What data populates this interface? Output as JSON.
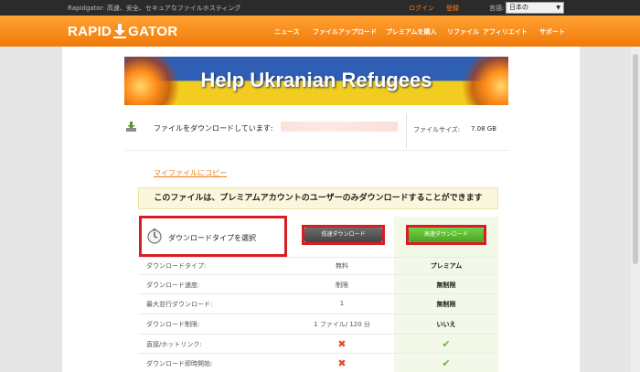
{
  "topbar": {
    "tagline": "Rapidgator: 高速、安全、セキュアなファイルホスティング",
    "login": "ログイン",
    "register": "登録",
    "language_label": "言語:",
    "language_value": "日本の"
  },
  "header": {
    "logo_left": "RAPID",
    "logo_right": "GATOR",
    "nav": [
      "ニュース",
      "ファイルアップロード",
      "プレミアムを購入",
      "リファイル",
      "アフィリエイト",
      "サポート"
    ]
  },
  "banner": {
    "title": "Help Ukranian Refugees"
  },
  "file": {
    "label": "ファイルをダウンロードしています:",
    "size_label": "ファイルサイズ:",
    "size_value": "7.08 GB"
  },
  "copy_link": "マイファイルにコピー",
  "premium_note": "このファイルは、プレミアムアカウントのユーザーのみダウンロードすることができます",
  "download_type_label": "ダウンロードタイプを選択",
  "buttons": {
    "slow": "低速ダウンロード",
    "fast": "高速ダウンロード"
  },
  "rows": [
    {
      "label": "ダウンロードタイプ:",
      "free": "無料",
      "premium": "プレミアム"
    },
    {
      "label": "ダウンロード速度:",
      "free": "制限",
      "premium": "無制限"
    },
    {
      "label": "最大並行ダウンロード:",
      "free": "1",
      "premium": "無制限"
    },
    {
      "label": "ダウンロード制限:",
      "free": "1 ファイル/ 120 分",
      "premium": "いいえ"
    },
    {
      "label": "直接/ホットリンク:",
      "free": "✖",
      "premium": "✔"
    },
    {
      "label": "ダウンロード即時開始:",
      "free": "✖",
      "premium": "✔"
    }
  ],
  "colors": {
    "accent": "#f28a12",
    "highlight": "#d81e25",
    "premium_green": "#5bb82e"
  }
}
